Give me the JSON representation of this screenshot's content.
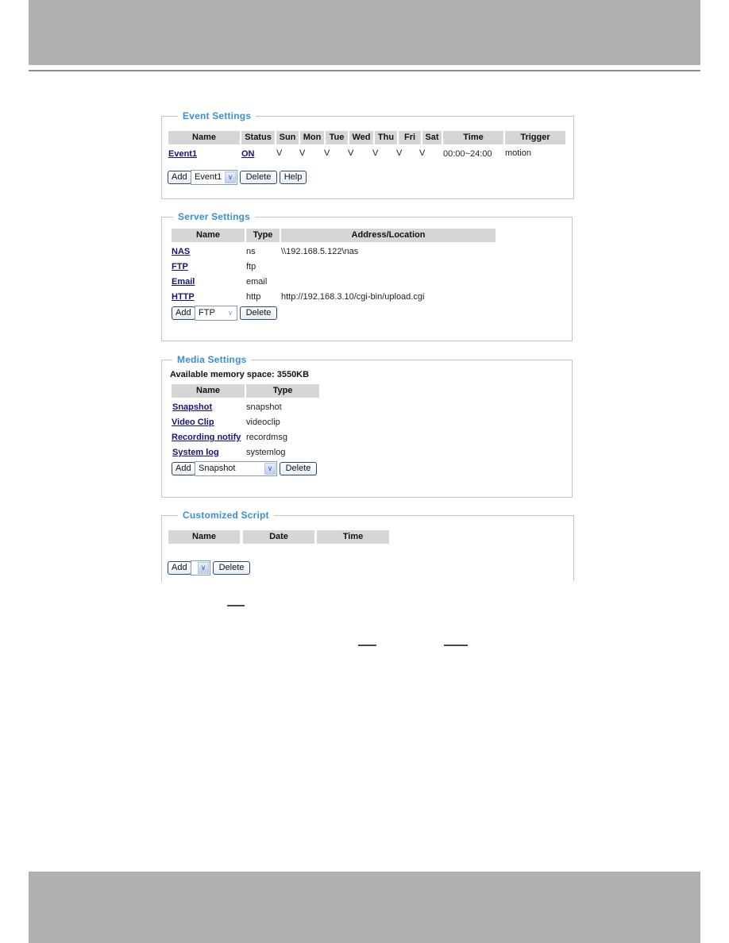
{
  "event_settings": {
    "title": "Event Settings",
    "columns": [
      "Name",
      "Status",
      "Sun",
      "Mon",
      "Tue",
      "Wed",
      "Thu",
      "Fri",
      "Sat",
      "Time",
      "Trigger"
    ],
    "rows": [
      {
        "name": "Event1",
        "status": "ON",
        "days": [
          "V",
          "V",
          "V",
          "V",
          "V",
          "V",
          "V"
        ],
        "time": "00:00~24:00",
        "trigger": "motion"
      }
    ],
    "add_label": "Add",
    "select_value": "Event1",
    "delete_label": "Delete",
    "help_label": "Help"
  },
  "server_settings": {
    "title": "Server Settings",
    "columns": [
      "Name",
      "Type",
      "Address/Location"
    ],
    "rows": [
      {
        "name": "NAS",
        "type": "ns",
        "address": "\\\\192.168.5.122\\nas"
      },
      {
        "name": "FTP",
        "type": "ftp",
        "address": ""
      },
      {
        "name": "Email",
        "type": "email",
        "address": ""
      },
      {
        "name": "HTTP",
        "type": "http",
        "address": "http://192.168.3.10/cgi-bin/upload.cgi"
      }
    ],
    "add_label": "Add",
    "select_value": "FTP",
    "delete_label": "Delete"
  },
  "media_settings": {
    "title": "Media Settings",
    "memory_label": "Available memory space: 3550KB",
    "columns": [
      "Name",
      "Type"
    ],
    "rows": [
      {
        "name": "Snapshot",
        "type": "snapshot"
      },
      {
        "name": "Video Clip",
        "type": "videoclip"
      },
      {
        "name": "Recording notify",
        "type": "recordmsg"
      },
      {
        "name": "System log",
        "type": "systemlog"
      }
    ],
    "add_label": "Add",
    "select_value": "Snapshot",
    "delete_label": "Delete"
  },
  "customized_script": {
    "title": "Customized Script",
    "columns": [
      "Name",
      "Date",
      "Time"
    ],
    "add_label": "Add",
    "select_value": "",
    "delete_label": "Delete"
  },
  "icons": {
    "dropdown_arrow": "chevron-down-icon"
  }
}
